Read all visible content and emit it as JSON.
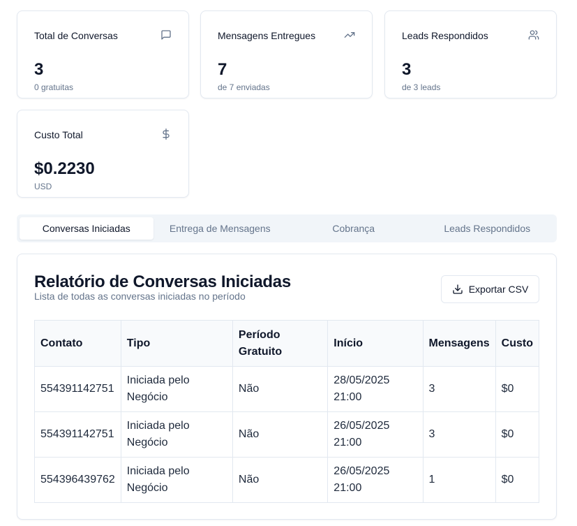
{
  "stats": [
    {
      "title": "Total de Conversas",
      "value": "3",
      "subtitle": "0 gratuitas",
      "icon": "message-square-icon"
    },
    {
      "title": "Mensagens Entregues",
      "value": "7",
      "subtitle": "de 7 enviadas",
      "icon": "trending-up-icon"
    },
    {
      "title": "Leads Respondidos",
      "value": "3",
      "subtitle": "de 3 leads",
      "icon": "users-icon"
    },
    {
      "title": "Custo Total",
      "value": "$0.2230",
      "subtitle": "USD",
      "icon": "dollar-sign-icon"
    }
  ],
  "tabs": [
    {
      "label": "Conversas Iniciadas",
      "active": true
    },
    {
      "label": "Entrega de Mensagens",
      "active": false
    },
    {
      "label": "Cobrança",
      "active": false
    },
    {
      "label": "Leads Respondidos",
      "active": false
    }
  ],
  "report": {
    "title": "Relatório de Conversas Iniciadas",
    "subtitle": "Lista de todas as conversas iniciadas no período",
    "export_label": "Exportar CSV",
    "export_icon": "download-icon",
    "columns": [
      "Contato",
      "Tipo",
      "Período Gratuito",
      "Início",
      "Mensagens",
      "Custo"
    ],
    "rows": [
      [
        "554391142751",
        "Iniciada pelo Negócio",
        "Não",
        "28/05/2025 21:00",
        "3",
        "$0"
      ],
      [
        "554391142751",
        "Iniciada pelo Negócio",
        "Não",
        "26/05/2025 21:00",
        "3",
        "$0"
      ],
      [
        "554396439762",
        "Iniciada pelo Negócio",
        "Não",
        "26/05/2025 21:00",
        "1",
        "$0"
      ]
    ]
  }
}
